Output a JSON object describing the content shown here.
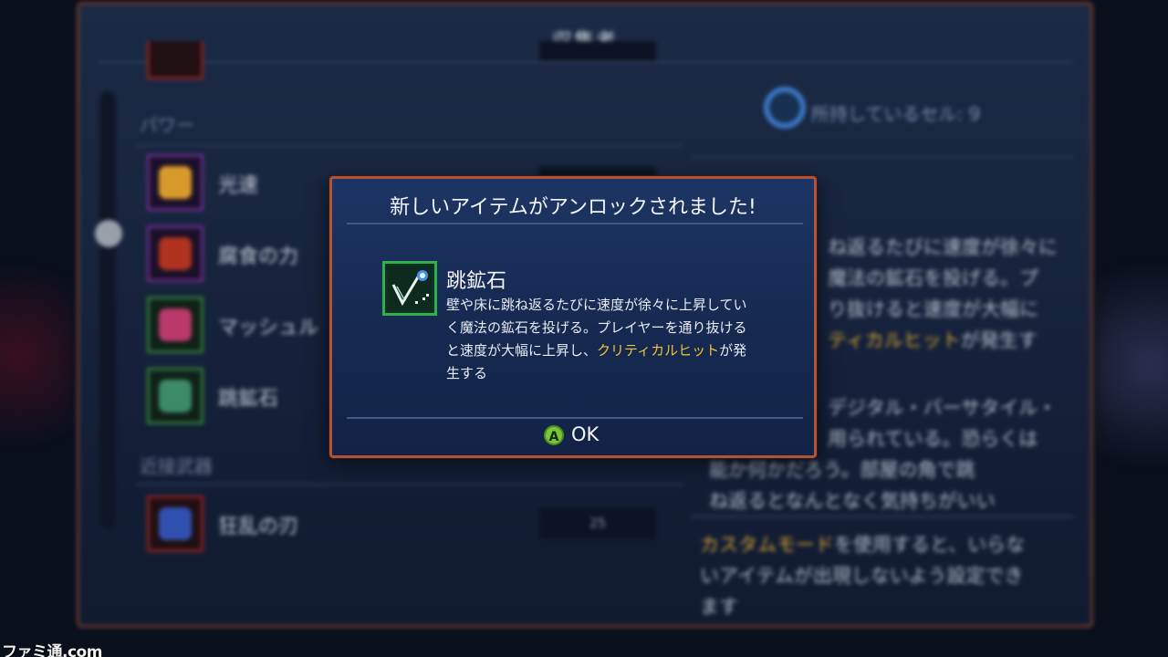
{
  "background": {
    "panel_title": "収集者",
    "categories": {
      "power": "パワー",
      "melee": "近接武器"
    },
    "items": [
      {
        "name": "光速",
        "frame": "purple"
      },
      {
        "name": "腐食の力",
        "frame": "purple"
      },
      {
        "name": "マッシュル",
        "frame": "green"
      },
      {
        "name": "跳鉱石",
        "frame": "green"
      },
      {
        "name": "狂乱の刃",
        "frame": "red",
        "cost": "25"
      }
    ],
    "cells_text": "所持しているセル: 9",
    "right_desc": {
      "line1": "ね返るたびに速度が徐々に",
      "line2": "魔法の鉱石を投げる。プ",
      "line3": "り抜けると速度が大幅に",
      "line4_hl": "ティカルヒット",
      "line4_rest": "が発生す",
      "lore1": "デジタル・バーサタイル・",
      "lore2": "用られている。恐らくは",
      "lore3": "能か何かだろう。部屋の角で跳",
      "lore4": "ね返るとなんとなく気持ちがいい",
      "tip_hl": "カスタムモード",
      "tip1_rest": "を使用すると、いらな",
      "tip2": "いアイテムが出現しないよう設定でき",
      "tip3": "ます"
    }
  },
  "dialog": {
    "title": "新しいアイテムがアンロックされました!",
    "item_name": "跳鉱石",
    "desc_lines": [
      "壁や床に跳ね返るたびに速度が徐々に上昇してい",
      "く魔法の鉱石を投げる。プレイヤーを通り抜ける"
    ],
    "desc_line3_pre": "と速度が大幅に上昇し、",
    "desc_line3_hl": "クリティカルヒット",
    "desc_line3_post": "が発",
    "desc_line4": "生する",
    "ok_button_glyph": "A",
    "ok_label": "OK"
  },
  "watermark": "ファミ通.com",
  "colors": {
    "dialog_border": "#b0533a",
    "highlight": "#f0c23a",
    "a_button": "#7bc43a",
    "item_frame": "#2fb04a"
  }
}
